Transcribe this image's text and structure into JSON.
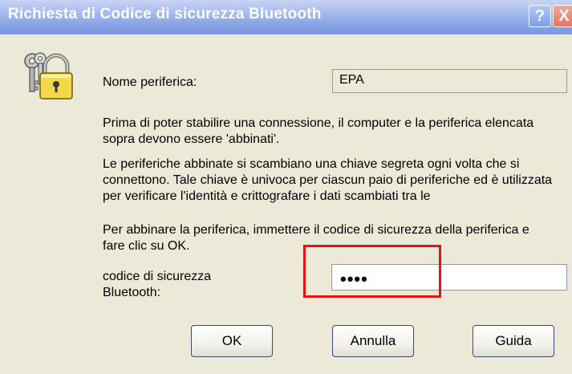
{
  "window": {
    "title": "Richiesta di Codice di sicurezza Bluetooth",
    "help_glyph": "?",
    "close_glyph": "X"
  },
  "dialog": {
    "device_label": "Nome periferica:",
    "device_value": "EPA",
    "para1": "Prima di poter stabilire una connessione, il computer e la periferica elencata sopra devono essere 'abbinati'.",
    "para2": "Le periferiche abbinate si scambiano una chiave segreta ogni volta che si connettono. Tale chiave è univoca per ciascun paio di periferiche ed è utilizzata per verificare l'identità e crittografare i dati scambiati tra le",
    "para3": "Per abbinare la periferica, immettere il codice di sicurezza della periferica e fare clic su OK.",
    "code_label": "codice di sicurezza Bluetooth:",
    "code_value": "••••"
  },
  "buttons": {
    "ok": "OK",
    "cancel": "Annulla",
    "help": "Guida"
  },
  "icons": {
    "dialog_icon": "keys-padlock-icon"
  },
  "colors": {
    "titlebar": "#8aa6e6",
    "dialog_bg": "#ece9d8",
    "highlight": "#e01515",
    "close": "#e27563"
  }
}
